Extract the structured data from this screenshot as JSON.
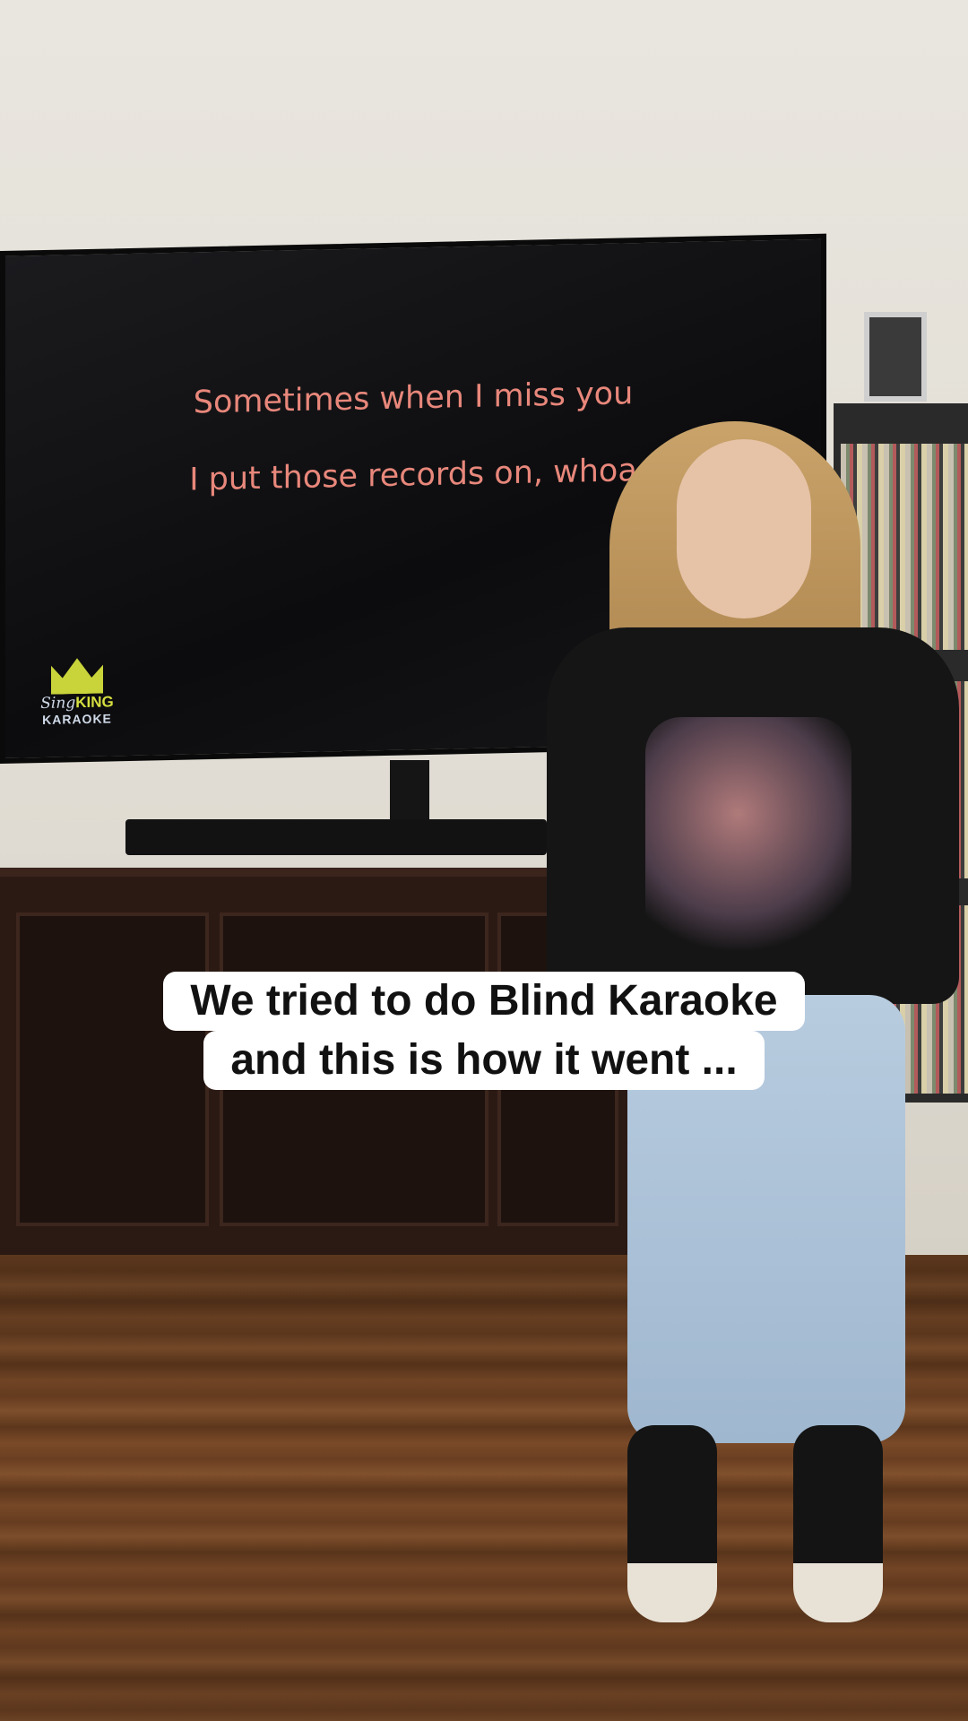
{
  "tv": {
    "lyric_line_1": "Sometimes when I miss you",
    "lyric_line_2": "I put those records on, whoa",
    "logo": {
      "line_1_sing": "Sing",
      "line_1_king": "KING",
      "line_2": "KARAOKE"
    },
    "colors": {
      "lyric": "#e8877b",
      "screen": "#111113"
    }
  },
  "caption": {
    "line_1": "We tried to do Blind Karaoke",
    "line_2": "and this is how it went ...",
    "background": "#ffffff",
    "text_color": "#111111"
  }
}
